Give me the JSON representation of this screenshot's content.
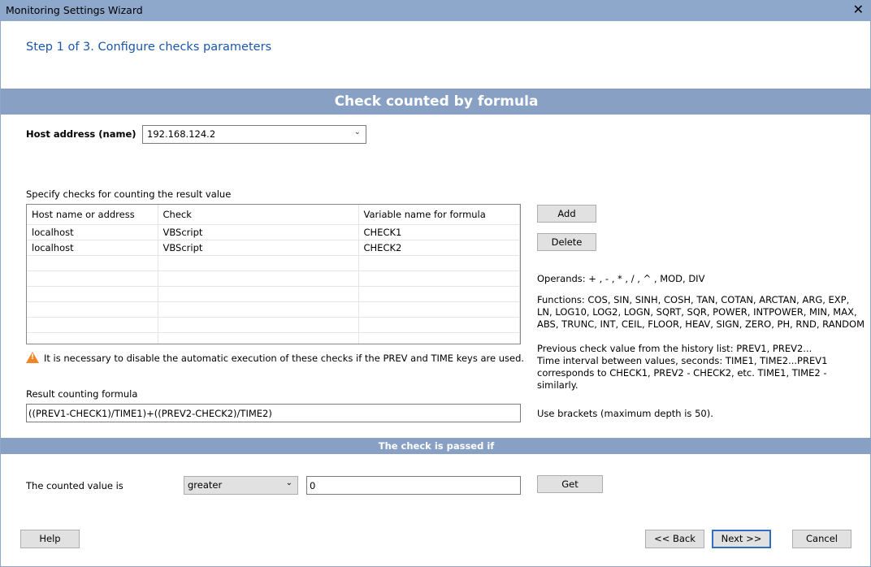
{
  "window": {
    "title": "Monitoring Settings Wizard",
    "close": "✕"
  },
  "step": "Step 1 of 3. Configure checks parameters",
  "section_title": "Check counted by formula",
  "host": {
    "label": "Host address (name)",
    "value": "192.168.124.2"
  },
  "checks": {
    "label": "Specify checks for counting the result value",
    "columns": [
      "Host name or address",
      "Check",
      "Variable name for formula"
    ],
    "rows": [
      [
        "localhost",
        "VBScript",
        "CHECK1"
      ],
      [
        "localhost",
        "VBScript",
        "CHECK2"
      ]
    ],
    "add": "Add",
    "delete": "Delete"
  },
  "warning": "It is necessary to disable the automatic execution of these checks if the PREV and TIME keys are used.",
  "help_text": {
    "operands": "Operands: + , - , * , / , ^ , MOD, DIV",
    "functions": "Functions: COS, SIN, SINH, COSH, TAN, COTAN, ARCTAN, ARG, EXP, LN, LOG10, LOG2, LOGN, SQRT, SQR, POWER, INTPOWER, MIN, MAX, ABS, TRUNC, INT, CEIL, FLOOR, HEAV, SIGN, ZERO, PH, RND, RANDOM",
    "previous": "Previous check value from the history list: PREV1, PREV2...",
    "time": "Time interval between values, seconds: TIME1, TIME2...PREV1 corresponds to CHECK1, PREV2 - CHECK2, etc. TIME1, TIME2 - similarly.",
    "brackets": "Use brackets (maximum depth is 50)."
  },
  "formula": {
    "label": "Result counting formula",
    "value": "((PREV1-CHECK1)/TIME1)+((PREV2-CHECK2)/TIME2)"
  },
  "pass_section": "The check is passed if",
  "condition": {
    "label": "The counted value is",
    "operator": "greater",
    "value": "0",
    "get": "Get"
  },
  "footer": {
    "help": "Help",
    "back": "<< Back",
    "next": "Next >>",
    "cancel": "Cancel"
  }
}
